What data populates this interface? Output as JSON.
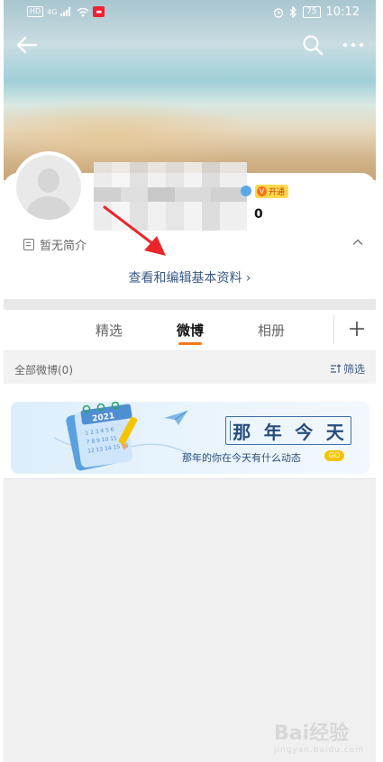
{
  "status_bar": {
    "network": "HD",
    "signal": "4G",
    "battery": "75",
    "time": "10:12"
  },
  "nav": {
    "back_icon": "arrow-left-icon",
    "search_icon": "search-icon",
    "more_icon": "more-dots-icon"
  },
  "profile": {
    "open_badge": "开通",
    "count": "0",
    "intro": "暂无简介",
    "edit_link": "查看和编辑基本资料 ›"
  },
  "tabs": {
    "items": [
      {
        "label": "精选"
      },
      {
        "label": "微博"
      },
      {
        "label": "相册"
      }
    ],
    "active": "微博",
    "plus_label": "+"
  },
  "filter": {
    "all_label": "全部微博(0)",
    "filter_label": "筛选"
  },
  "banner": {
    "title_chars": [
      "那",
      "年",
      "今",
      "天"
    ],
    "subtitle": "那年的你在今天有什么动态",
    "go": "GO",
    "year": "2021"
  },
  "watermark": {
    "text": "Bai经验",
    "sub": "jingyan.baidu.com"
  },
  "colors": {
    "accent": "#f27a1a",
    "link": "#3a5a86",
    "annotation_arrow": "#e8262a"
  }
}
